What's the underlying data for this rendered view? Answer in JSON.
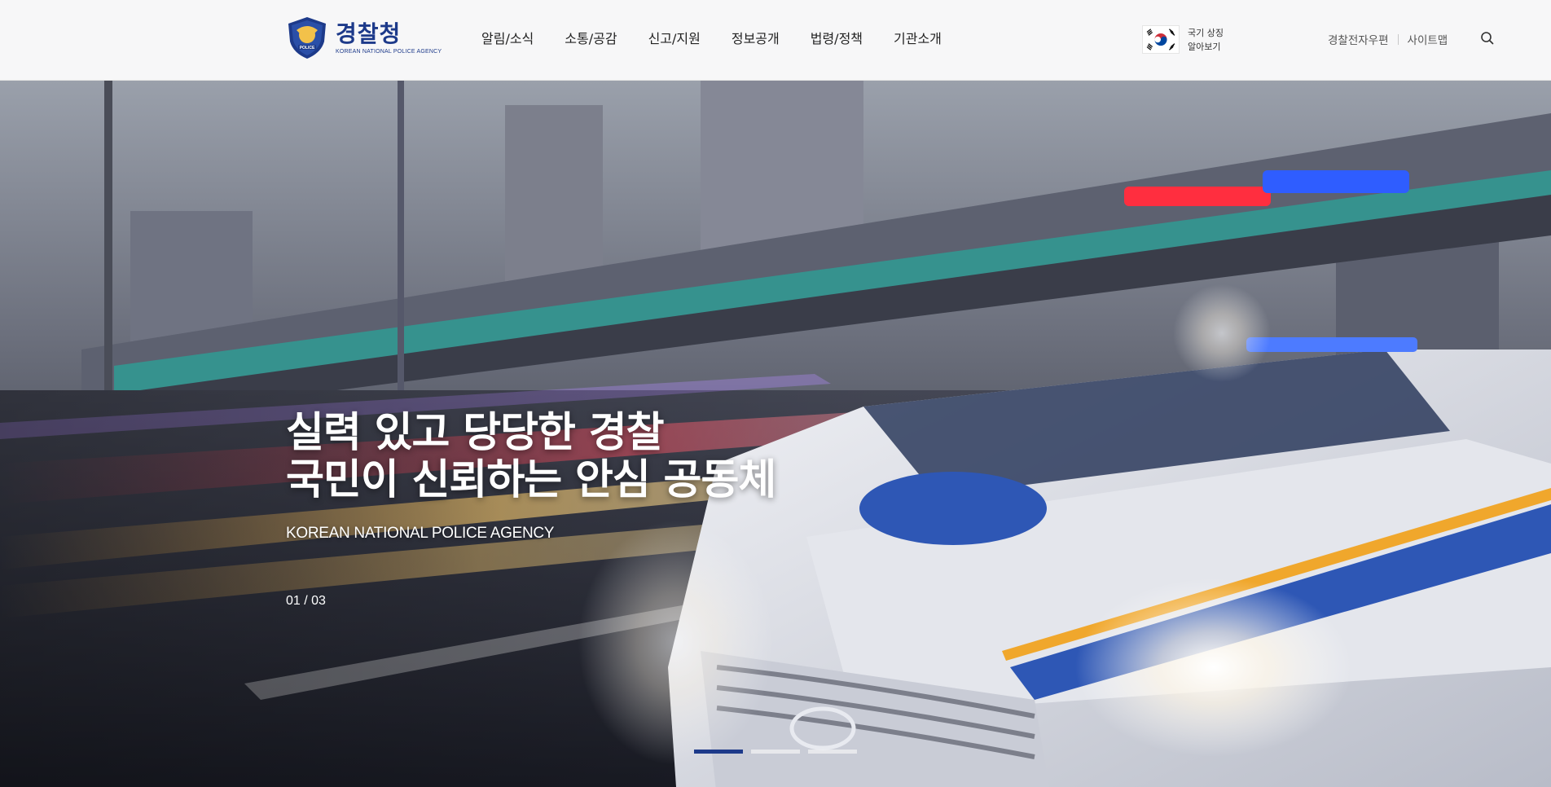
{
  "header": {
    "logo": {
      "name_ko": "경찰청",
      "name_en": "KOREAN NATIONAL POLICE AGENCY",
      "emblem_text": "POLICE"
    },
    "nav": [
      "알림/소식",
      "소통/공감",
      "신고/지원",
      "정보공개",
      "법령/정책",
      "기관소개"
    ],
    "symbol": {
      "line1": "국기 상징",
      "line2": "알아보기"
    },
    "util": {
      "mail": "경찰전자우편",
      "sitemap": "사이트맵"
    },
    "search_icon": "search-icon"
  },
  "hero": {
    "title_line1": "실력 있고 당당한 경찰",
    "title_line2": "국민이 신뢰하는 안심 공동체",
    "subtitle": "KOREAN NATIONAL POLICE AGENCY",
    "counter": "01 / 03",
    "slides_total": 3,
    "active_slide": 1
  },
  "colors": {
    "brand": "#1d3a8a",
    "header_bg": "#f7f7f8"
  }
}
